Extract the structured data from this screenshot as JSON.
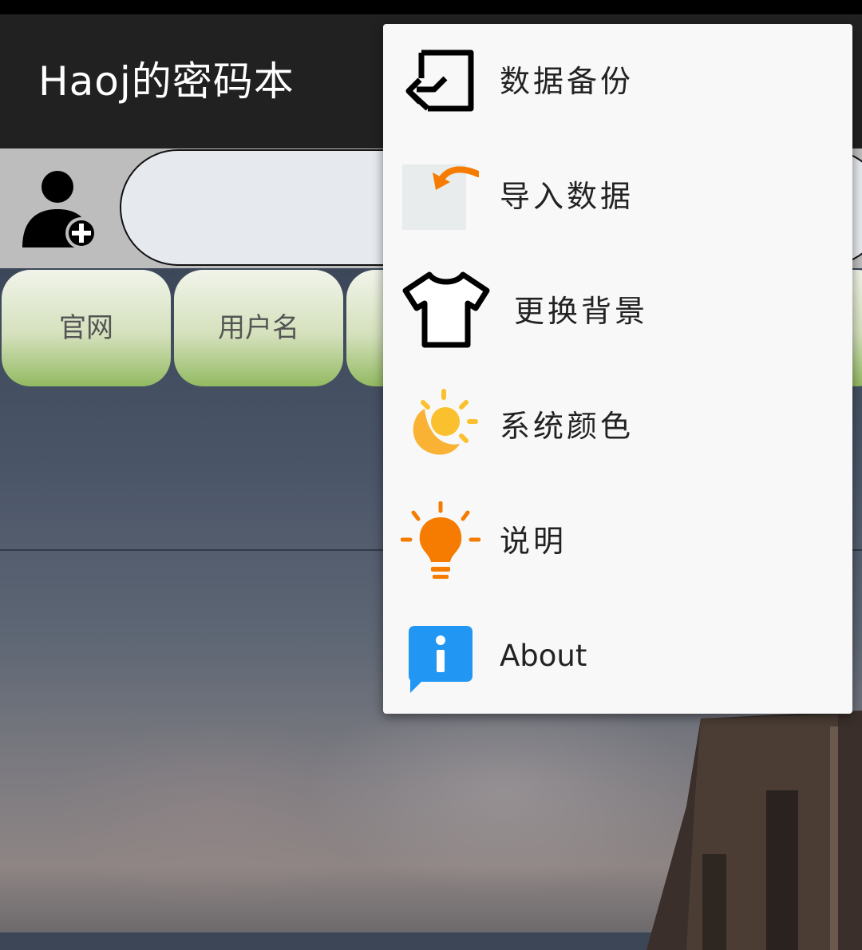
{
  "app": {
    "title": "Haoj的密码本"
  },
  "search": {
    "value": ""
  },
  "columns": [
    {
      "label": "官网"
    },
    {
      "label": "用户名"
    },
    {
      "label": ""
    }
  ],
  "menu": {
    "items": [
      {
        "label": "数据备份",
        "icon": "backup-icon"
      },
      {
        "label": "导入数据",
        "icon": "import-icon"
      },
      {
        "label": "更换背景",
        "icon": "tshirt-icon"
      },
      {
        "label": "系统颜色",
        "icon": "sun-moon-icon"
      },
      {
        "label": "说明",
        "icon": "lightbulb-icon"
      },
      {
        "label": "About",
        "icon": "info-icon"
      }
    ]
  },
  "colors": {
    "app_bar": "#212121",
    "menu_bg": "#f8f8f8",
    "accent_orange": "#f57c00",
    "info_blue": "#2196f3",
    "sun_yellow": "#fbc02d"
  }
}
